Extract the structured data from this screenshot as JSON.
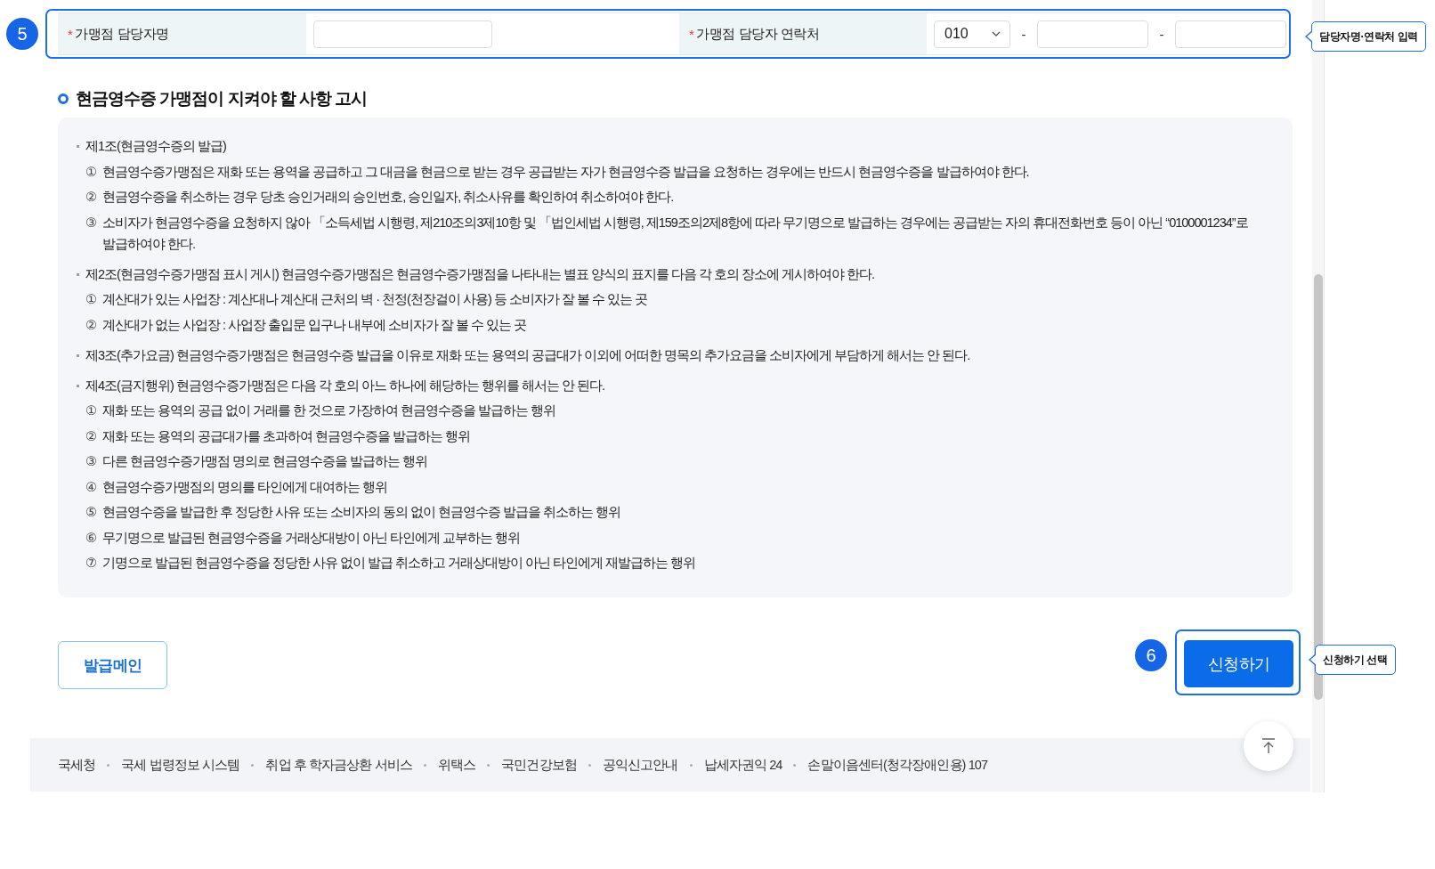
{
  "contact_form": {
    "annotation": {
      "step": "5",
      "callout": "담당자명·연락처 입력"
    },
    "fields": [
      {
        "kind": "text",
        "required_mark": "*",
        "label": "가맹점 담당자명"
      },
      {
        "kind": "phone",
        "required_mark": "*",
        "label": "가맹점 담당자 연락처",
        "parts": [
          {
            "kind": "select",
            "value": "010"
          },
          {
            "kind": "separator",
            "text": "-"
          },
          {
            "kind": "input"
          },
          {
            "kind": "separator",
            "text": "-"
          },
          {
            "kind": "input"
          }
        ]
      }
    ]
  },
  "notice": {
    "title": "현금영수증 가맹점이 지켜야 할 사항 고시",
    "articles": [
      {
        "text": "제1조(현금영수증의 발급)",
        "items": [
          {
            "marker": "①",
            "text": "현금영수증가맹점은 재화 또는 용역을 공급하고 그 대금을 현금으로 받는 경우 공급받는 자가 현금영수증 발급을 요청하는 경우에는 반드시 현금영수증을 발급하여야 한다."
          },
          {
            "marker": "②",
            "text": "현금영수증을 취소하는 경우 당초 승인거래의 승인번호, 승인일자, 취소사유를 확인하여 취소하여야 한다."
          },
          {
            "marker": "③",
            "text": "소비자가 현금영수증을 요청하지 않아 「소득세법 시행령, 제210조의3제10항 및 「법인세법 시행령, 제159조의2제8항에 따라 무기명으로 발급하는 경우에는 공급받는 자의 휴대전화번호 등이 아닌 “0100001234”로 발급하여야 한다."
          }
        ]
      },
      {
        "text": "제2조(현금영수증가맹점 표시 게시) 현금영수증가맹점은 현금영수증가맹점을 나타내는 별표 양식의 표지를 다음 각 호의 장소에 게시하여야 한다.",
        "items": [
          {
            "marker": "①",
            "text": "계산대가 있는 사업장 : 계산대나 계산대 근처의 벽 · 천정(천장걸이 사용) 등 소비자가 잘 볼 수 있는 곳"
          },
          {
            "marker": "②",
            "text": "계산대가 없는 사업장 : 사업장 출입문 입구나 내부에 소비자가 잘 볼 수 있는 곳"
          }
        ]
      },
      {
        "text": "제3조(추가요금) 현금영수증가맹점은 현금영수증 발급을 이유로 재화 또는 용역의 공급대가 이외에 어떠한 명목의 추가요금을 소비자에게 부담하게 해서는 안 된다."
      },
      {
        "text": "제4조(금지행위) 현금영수증가맹점은 다음 각 호의 아느 하나에 해당하는 행위를 해서는 안 된다.",
        "items": [
          {
            "marker": "①",
            "text": "재화 또는 용역의 공급 없이 거래를 한 것으로 가장하여 현금영수증을 발급하는 행위"
          },
          {
            "marker": "②",
            "text": "재화 또는 용역의 공급대가를 초과하여 현금영수증을 발급하는 행위"
          },
          {
            "marker": "③",
            "text": "다른 현금영수증가맹점 명의로 현금영수증을 발급하는 행위"
          },
          {
            "marker": "④",
            "text": "현금영수증가맹점의 명의를 타인에게 대여하는 행위"
          },
          {
            "marker": "⑤",
            "text": "현금영수증을 발급한 후 정당한 사유 또는 소비자의 동의 없이 현금영수증 발급을 취소하는 행위"
          },
          {
            "marker": "⑥",
            "text": "무기명으로 발급된 현금영수증을 거래상대방이 아닌 타인에게 교부하는 행위"
          },
          {
            "marker": "⑦",
            "text": "기명으로 발급된 현금영수증을 정당한 사유 없이 발급 취소하고 거래상대방이 아닌 타인에게 재발급하는 행위"
          }
        ]
      }
    ]
  },
  "actions": {
    "buttons": [
      {
        "kind": "secondary",
        "label": "발급메인"
      },
      {
        "kind": "primary",
        "label": "신청하기",
        "annotation": {
          "step": "6",
          "callout": "신청하기 선택"
        }
      }
    ]
  },
  "footer": {
    "links": [
      "국세청",
      "국세 법령정보 시스템",
      "취업 후 학자금상환 서비스",
      "위택스",
      "국민건강보험",
      "공익신고안내",
      "납세자권익 24",
      "손말이음센터(청각장애인용) 107"
    ]
  }
}
